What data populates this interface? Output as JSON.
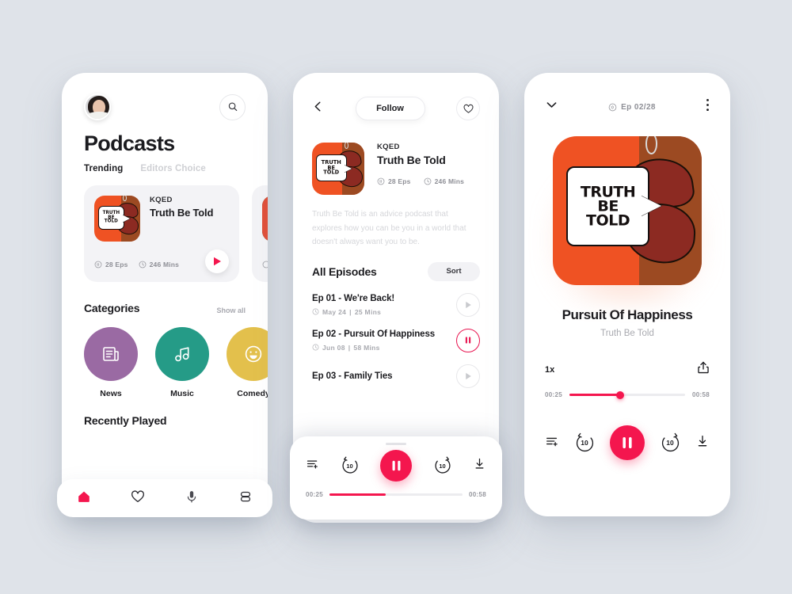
{
  "theme": {
    "background": "#dfe3e9",
    "accent": "#f4164e",
    "accent_alt": "#e8134f",
    "art_orange": "#ef5223",
    "art_brown": "#9c4a22",
    "art_lip": "#8c2a22",
    "text_dark": "#1b1b1f",
    "text_muted": "#a9aab0",
    "card_bg": "#f3f3f6"
  },
  "artwork": {
    "line1": "TRUTH",
    "line2": "BE",
    "line3": "TOLD",
    "alt": "truth-be-told-cover-art"
  },
  "home": {
    "title": "Podcasts",
    "avatar_label": "user-avatar",
    "search_label": "search-icon",
    "tabs": [
      {
        "label": "Trending",
        "active": true
      },
      {
        "label": "Editors Choice",
        "active": false
      }
    ],
    "cards": [
      {
        "publisher": "KQED",
        "title": "Truth Be Told",
        "episodes": "28 Eps",
        "duration": "246 Mins",
        "play_label": "play-icon"
      },
      {
        "publisher": "",
        "title": "",
        "episodes": "",
        "duration": "",
        "play_label": "play-icon"
      }
    ],
    "categories_heading": "Categories",
    "categories_link": "Show all",
    "categories": [
      {
        "label": "News",
        "color": "#9a6aa3",
        "icon": "news-icon"
      },
      {
        "label": "Music",
        "color": "#259b87",
        "icon": "music-note-icon"
      },
      {
        "label": "Comedy",
        "color": "#e3c04c",
        "icon": "smiley-icon"
      }
    ],
    "recently_played_heading": "Recently Played",
    "tabbar": [
      {
        "name": "home",
        "icon": "home-icon",
        "active": true
      },
      {
        "name": "favorites",
        "icon": "heart-icon",
        "active": false
      },
      {
        "name": "podcasts",
        "icon": "microphone-icon",
        "active": false
      },
      {
        "name": "library",
        "icon": "library-icon",
        "active": false
      }
    ]
  },
  "show": {
    "back_label": "back-icon",
    "follow_label": "Follow",
    "like_label": "heart-icon",
    "publisher": "KQED",
    "title": "Truth Be Told",
    "episodes": "28 Eps",
    "duration": "246 Mins",
    "description": "Truth Be Told is an advice podcast that explores how you can be you in a world that doesn't always want you to be.",
    "episodes_heading": "All Episodes",
    "sort_label": "Sort",
    "episode_list": [
      {
        "title": "Ep 01 - We're Back!",
        "date": "May 24",
        "length": "25 Mins",
        "state": "paused"
      },
      {
        "title": "Ep 02 - Pursuit Of Happiness",
        "date": "Jun 08",
        "length": "58 Mins",
        "state": "playing"
      },
      {
        "title": "Ep 03 - Family Ties",
        "date": "",
        "length": "",
        "state": "paused"
      }
    ],
    "mini_player": {
      "queue_label": "queue-add-icon",
      "rewind": "10",
      "forward": "10",
      "play_state": "pause-icon",
      "download_label": "download-icon",
      "elapsed": "00:25",
      "remaining": "00:58",
      "progress_percent": 42
    }
  },
  "player": {
    "collapse_label": "chevron-down-icon",
    "episode_counter": "Ep 02/28",
    "counter_icon": "episodes-icon",
    "more_label": "more-vertical-icon",
    "track_title": "Pursuit Of Happiness",
    "track_show": "Truth Be Told",
    "speed": "1x",
    "share_label": "share-icon",
    "elapsed": "00:25",
    "remaining": "00:58",
    "progress_percent": 44,
    "controls": {
      "queue_label": "queue-add-icon",
      "rewind": "10",
      "forward": "10",
      "play_state": "pause-icon",
      "download_label": "download-icon"
    }
  }
}
